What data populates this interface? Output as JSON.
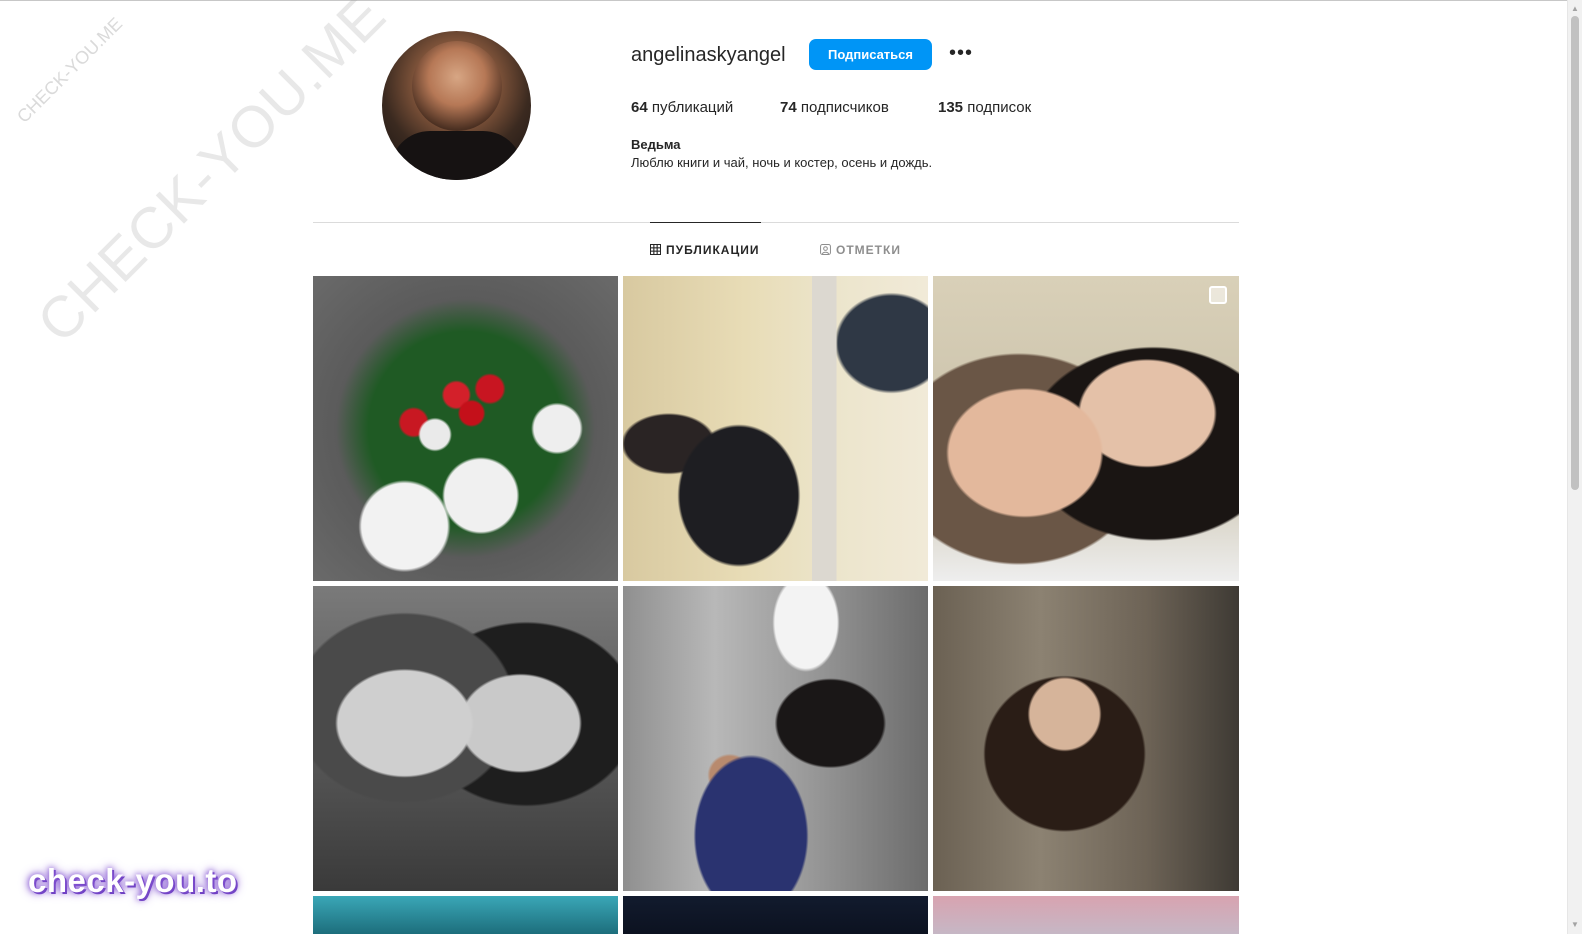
{
  "watermarks": {
    "large": "CHECK-YOU.ME",
    "small": "CHECK-YOU.ME",
    "bottom": "check-you.to"
  },
  "profile": {
    "username": "angelinaskyangel",
    "follow_label": "Подписаться",
    "more_label": "•••",
    "stats": {
      "posts_count": "64",
      "posts_label": "публикаций",
      "followers_count": "74",
      "followers_label": "подписчиков",
      "following_count": "135",
      "following_label": "подписок"
    },
    "bio_name": "Ведьма",
    "bio_text": "Люблю книги и чай, ночь и костер, осень и дождь."
  },
  "tabs": {
    "posts": "ПУБЛИКАЦИИ",
    "tagged": "ОТМЕТКИ",
    "active": "posts"
  },
  "colors": {
    "accent": "#0095f6",
    "text": "#262626",
    "muted": "#8e8e8e",
    "divider": "#dbdbdb"
  },
  "grid": {
    "posts": [
      {
        "kind": "photo",
        "multi": false
      },
      {
        "kind": "photo",
        "multi": false
      },
      {
        "kind": "photo",
        "multi": true
      },
      {
        "kind": "photo",
        "multi": false
      },
      {
        "kind": "photo",
        "multi": false
      },
      {
        "kind": "photo",
        "multi": false
      },
      {
        "kind": "photo",
        "multi": false
      },
      {
        "kind": "photo",
        "multi": false
      },
      {
        "kind": "photo",
        "multi": false
      }
    ]
  }
}
